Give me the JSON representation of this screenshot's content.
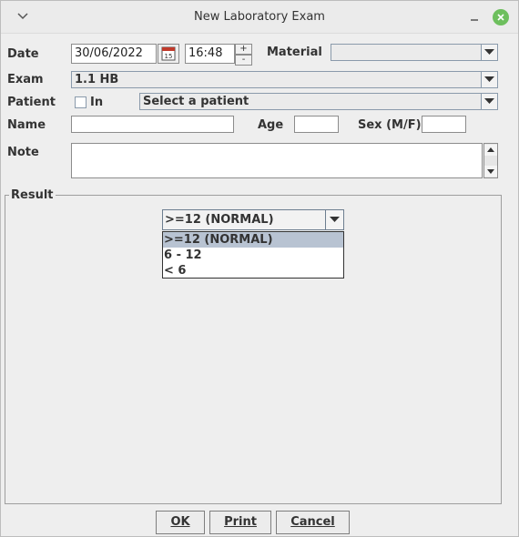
{
  "window": {
    "title": "New Laboratory Exam"
  },
  "labels": {
    "date": "Date",
    "material": "Material",
    "exam": "Exam",
    "patient": "Patient",
    "in": "In",
    "name": "Name",
    "age": "Age",
    "sex": "Sex (M/F)",
    "note": "Note",
    "result": "Result"
  },
  "fields": {
    "date_value": "30/06/2022",
    "time_value": "16:48",
    "spin_up": "+",
    "spin_down": "-",
    "material_value": "",
    "exam_value": "1.1 HB",
    "patient_value": "Select a patient",
    "name_value": "",
    "age_value": "",
    "sex_value": "",
    "note_value": ""
  },
  "result": {
    "selected": ">=12 (NORMAL)",
    "options": [
      ">=12 (NORMAL)",
      "6 - 12",
      "< 6"
    ]
  },
  "buttons": {
    "ok": "OK",
    "print": "Print",
    "cancel": "Cancel"
  },
  "icons": {
    "calendar": "calendar-icon",
    "dropdown": "chevron-down-icon",
    "close": "close-icon"
  },
  "colors": {
    "selection": "#b8c3d2",
    "close_button": "#6dbf5d"
  }
}
